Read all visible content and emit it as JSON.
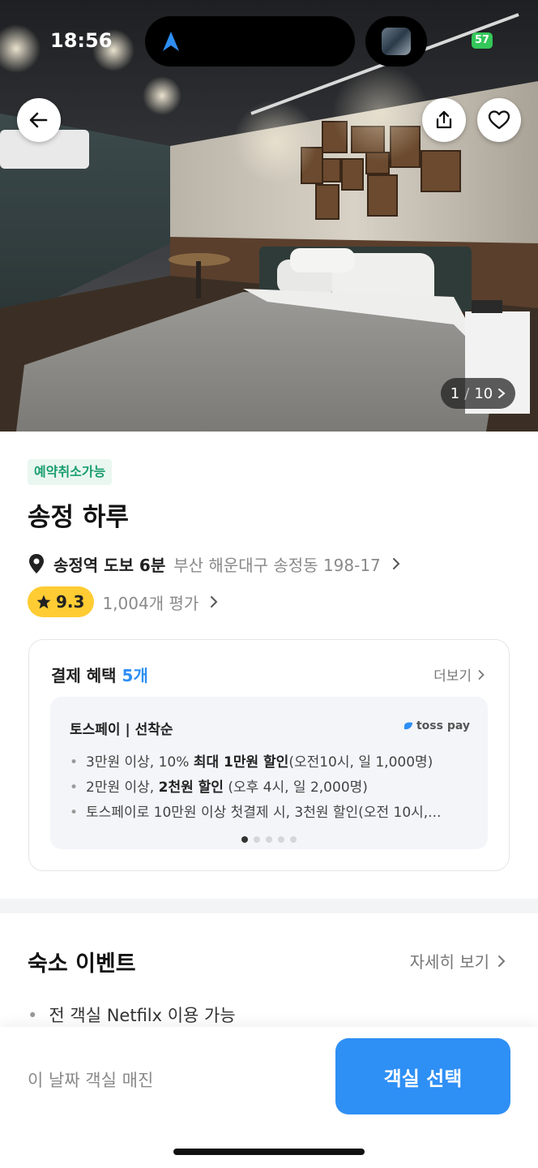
{
  "status_bar": {
    "time": "18:56",
    "battery": "57"
  },
  "gallery": {
    "current": "1",
    "separator": "/",
    "total": "10"
  },
  "tag": "예약취소가능",
  "hotel": {
    "name": "송정 하루",
    "walk_info": "송정역 도보 6분",
    "address": "부산 해운대구 송정동 198-17",
    "rating": "9.3",
    "review_count": "1,004개 평가"
  },
  "benefits": {
    "title": "결제 혜택",
    "count": "5개",
    "more_label": "더보기",
    "card_title": "토스페이 | 선착순",
    "provider_logo": "toss pay",
    "items": [
      {
        "pre": "3만원 이상, 10% ",
        "bold": "최대 1만원 할인",
        "post": "(오전10시, 일 1,000명)"
      },
      {
        "pre": "2만원 이상, ",
        "bold": "2천원 할인",
        "post": " (오후 4시, 일 2,000명)"
      },
      {
        "pre": "토스페이로 10만원 이상 첫결제 시, 3천원 할인(오전 10시,...",
        "bold": "",
        "post": ""
      }
    ],
    "page_dots": 5,
    "active_dot": 0
  },
  "event_section": {
    "title": "숙소 이벤트",
    "more_label": "자세히 보기",
    "items": [
      "전 객실 Netfilx 이용 가능"
    ]
  },
  "bottom_bar": {
    "status_text": "이 날짜 객실 매진",
    "select_button": "객실 선택"
  },
  "colors": {
    "accent": "#2e8ff5",
    "rating_badge": "#ffcc33",
    "tag_text": "#1a9e6e",
    "tag_bg": "#eaf7f1"
  },
  "icons": {
    "back": "arrow-left-icon",
    "share": "share-icon",
    "favorite": "heart-icon",
    "location": "location-pin-icon",
    "star": "star-icon",
    "navigation": "navigation-arrow-icon"
  }
}
